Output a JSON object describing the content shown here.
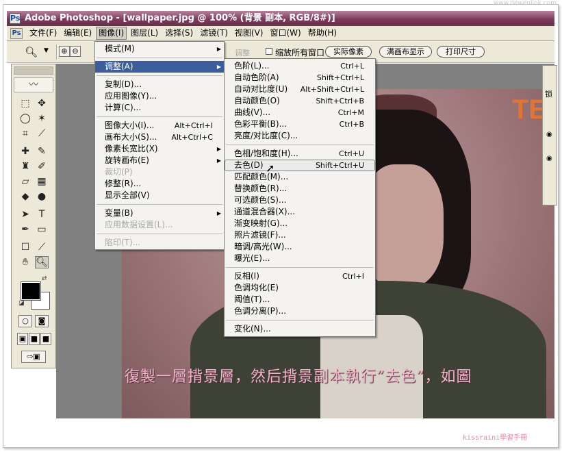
{
  "window": {
    "title": "Adobe Photoshop - [wallpaper.jpg @ 100% (背景 副本, RGB/8#)]"
  },
  "watermark_top": "www.dewenlink.com",
  "menubar": {
    "items": [
      "文件(F)",
      "编辑(E)",
      "图像(I)",
      "图层(L)",
      "选择(S)",
      "滤镜(T)",
      "视图(V)",
      "窗口(W)",
      "帮助(H)"
    ],
    "active_index": 2
  },
  "options": {
    "dim_label": "调整",
    "resize_all_windows": "缩放所有窗口",
    "buttons": [
      "实际像素",
      "满画布显示",
      "打印尺寸"
    ]
  },
  "image_menu": [
    {
      "label": "模式(M)",
      "submenu": true
    },
    {
      "sep": true
    },
    {
      "label": "调整(A)",
      "submenu": true,
      "hover": true
    },
    {
      "sep": true
    },
    {
      "label": "复制(D)..."
    },
    {
      "label": "应用图像(Y)..."
    },
    {
      "label": "计算(C)..."
    },
    {
      "sep": true
    },
    {
      "label": "图像大小(I)...",
      "shortcut": "Alt+Ctrl+I"
    },
    {
      "label": "画布大小(S)...",
      "shortcut": "Alt+Ctrl+C"
    },
    {
      "label": "像素长宽比(X)",
      "submenu": true
    },
    {
      "label": "旋转画布(E)",
      "submenu": true
    },
    {
      "label": "裁切(P)",
      "disabled": true
    },
    {
      "label": "修整(R)..."
    },
    {
      "label": "显示全部(V)"
    },
    {
      "sep": true
    },
    {
      "label": "变量(B)",
      "submenu": true
    },
    {
      "label": "应用数据设置(L)...",
      "disabled": true
    },
    {
      "sep": true
    },
    {
      "label": "陷印(T)...",
      "disabled": true
    }
  ],
  "adjust_menu": [
    {
      "label": "色阶(L)...",
      "shortcut": "Ctrl+L"
    },
    {
      "label": "自动色阶(A)",
      "shortcut": "Shift+Ctrl+L"
    },
    {
      "label": "自动对比度(U)",
      "shortcut": "Alt+Shift+Ctrl+L"
    },
    {
      "label": "自动颜色(O)",
      "shortcut": "Shift+Ctrl+B"
    },
    {
      "label": "曲线(V)...",
      "shortcut": "Ctrl+M"
    },
    {
      "label": "色彩平衡(B)...",
      "shortcut": "Ctrl+B"
    },
    {
      "label": "亮度/对比度(C)..."
    },
    {
      "sep": true
    },
    {
      "label": "色相/饱和度(H)...",
      "shortcut": "Ctrl+U"
    },
    {
      "label": "去色(D)",
      "shortcut": "Shift+Ctrl+U",
      "highlight": true
    },
    {
      "label": "匹配颜色(M)..."
    },
    {
      "label": "替换颜色(R)..."
    },
    {
      "label": "可选颜色(S)..."
    },
    {
      "label": "通道混合器(X)..."
    },
    {
      "label": "渐变映射(G)..."
    },
    {
      "label": "照片滤镜(F)..."
    },
    {
      "label": "暗调/高光(W)..."
    },
    {
      "label": "曝光(E)..."
    },
    {
      "sep": true
    },
    {
      "label": "反相(I)",
      "shortcut": "Ctrl+I"
    },
    {
      "label": "色调均化(E)"
    },
    {
      "label": "阈值(T)..."
    },
    {
      "label": "色调分离(P)..."
    },
    {
      "sep": true
    },
    {
      "label": "变化(N)..."
    }
  ],
  "layers_panel": {
    "lock_label": "锁"
  },
  "photo_text": "TE",
  "caption": "復製一層揹景層，然后揹景副本執行”去色”，如圖",
  "signature": "kissraini學習手冊",
  "colors": {
    "titlebar": "#7b3c5c",
    "menu_hover": "#3b5d9b",
    "caption": "#f3b4cb",
    "accent_text": "#e07430"
  }
}
